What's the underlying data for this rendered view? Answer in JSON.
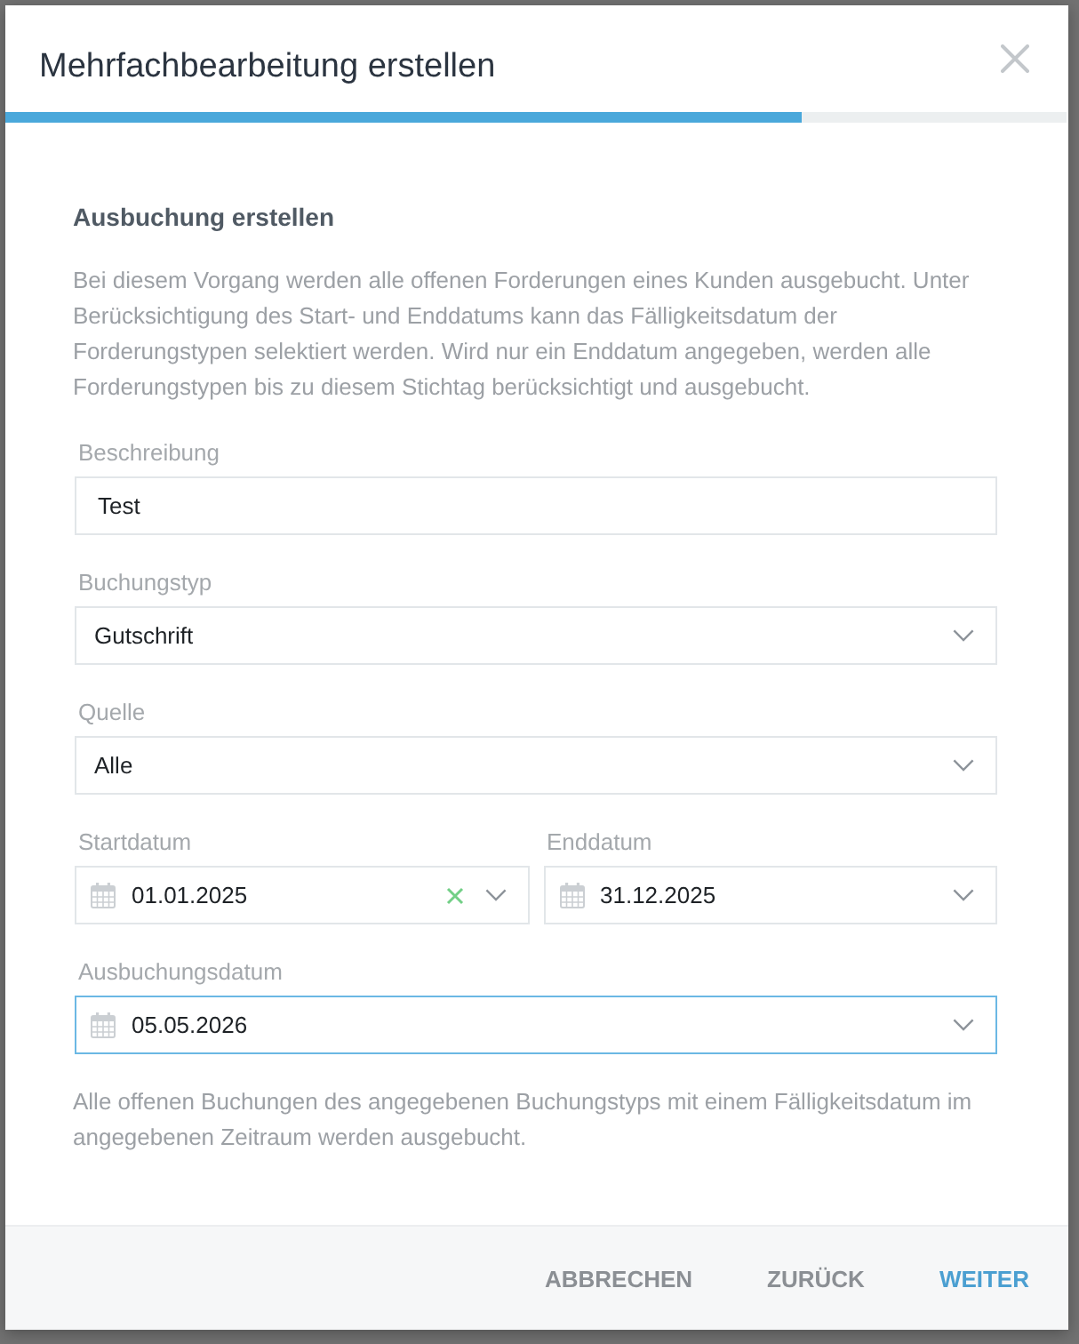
{
  "dialog": {
    "title": "Mehrfachbearbeitung erstellen",
    "progress": {
      "level": 0.75
    }
  },
  "section": {
    "heading": "Ausbuchung erstellen",
    "description": "Bei diesem Vorgang werden alle offenen Forderungen eines Kunden ausgebucht. Unter Berücksichtigung des Start- und Enddatums kann das Fälligkeitsdatum der Forderungstypen selektiert werden. Wird nur ein Enddatum angegeben, werden alle Forderungstypen bis zu diesem Stichtag berücksichtigt und ausgebucht."
  },
  "form_rows": [
    {
      "fields": [
        {
          "kind": "text",
          "label": "Beschreibung",
          "value": "Test",
          "focused": false,
          "clearable": false
        }
      ]
    },
    {
      "fields": [
        {
          "kind": "select",
          "label": "Buchungstyp",
          "value": "Gutschrift",
          "focused": false,
          "clearable": false
        }
      ]
    },
    {
      "fields": [
        {
          "kind": "select",
          "label": "Quelle",
          "value": "Alle",
          "focused": false,
          "clearable": false
        }
      ]
    },
    {
      "fields": [
        {
          "kind": "date",
          "label": "Startdatum",
          "value": "01.01.2025",
          "focused": false,
          "clearable": true
        },
        {
          "kind": "date",
          "label": "Enddatum",
          "value": "31.12.2025",
          "focused": false,
          "clearable": false
        }
      ]
    },
    {
      "fields": [
        {
          "kind": "date",
          "label": "Ausbuchungsdatum",
          "value": "05.05.2026",
          "focused": true,
          "clearable": false
        }
      ]
    }
  ],
  "note": "Alle offenen Buchungen des angegebenen Buchungstyps mit einem Fälligkeitsdatum im angegebenen Zeitraum werden ausgebucht.",
  "buttons": [
    {
      "label": "ABBRECHEN",
      "kind": "secondary"
    },
    {
      "label": "ZURÜCK",
      "kind": "secondary"
    },
    {
      "label": "WEITER",
      "kind": "primary"
    }
  ]
}
